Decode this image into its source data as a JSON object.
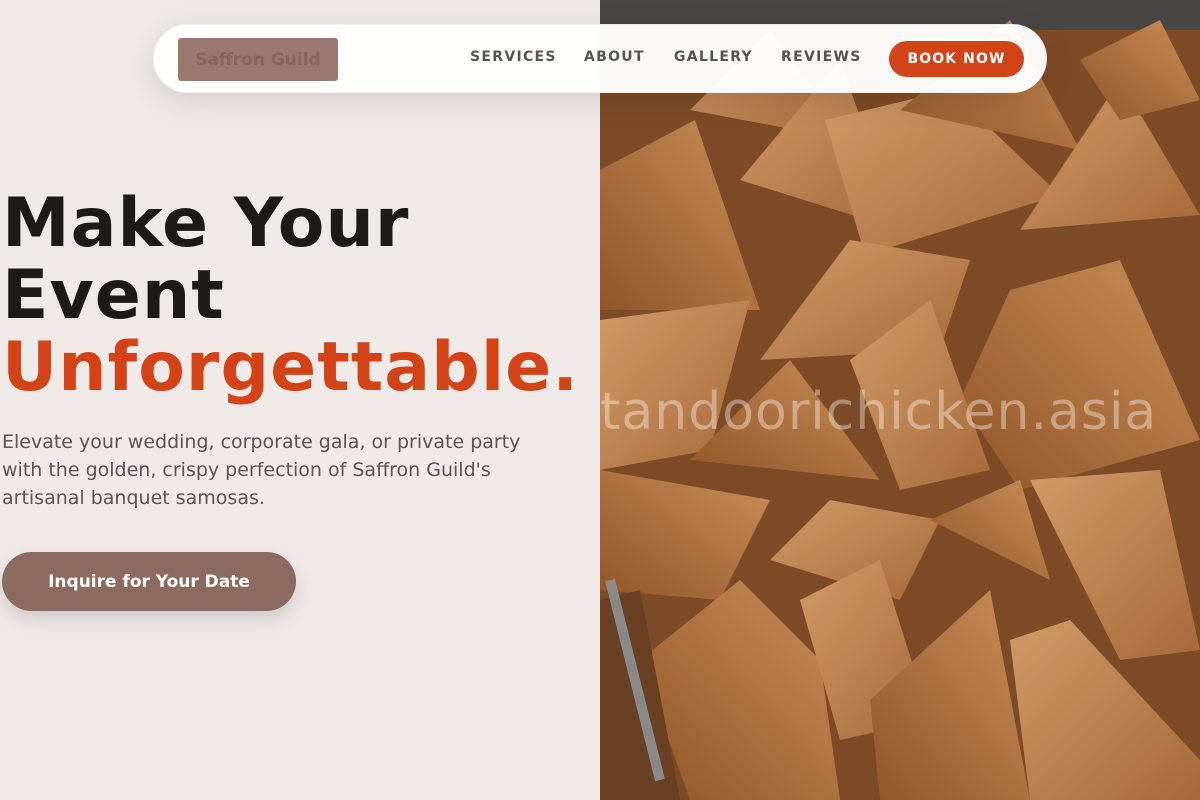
{
  "brand": {
    "name": "Saffron Guild"
  },
  "nav": {
    "items": [
      "SERVICES",
      "ABOUT",
      "GALLERY",
      "REVIEWS"
    ],
    "cta": "BOOK NOW"
  },
  "hero": {
    "title_line1": "Make Your",
    "title_line2": "Event",
    "title_accent": "Unforgettable.",
    "description": "Elevate your wedding, corporate gala, or private party with the golden, crispy perfection of Saffron Guild's artisanal banquet samosas.",
    "cta": "Inquire for Your Date"
  },
  "image": {
    "watermark": "tandoorichicken.asia"
  },
  "colors": {
    "accent": "#d34318",
    "cta_brown": "#8d6a60",
    "background": "#efe9e8",
    "text_dark": "#1d1b1a"
  }
}
